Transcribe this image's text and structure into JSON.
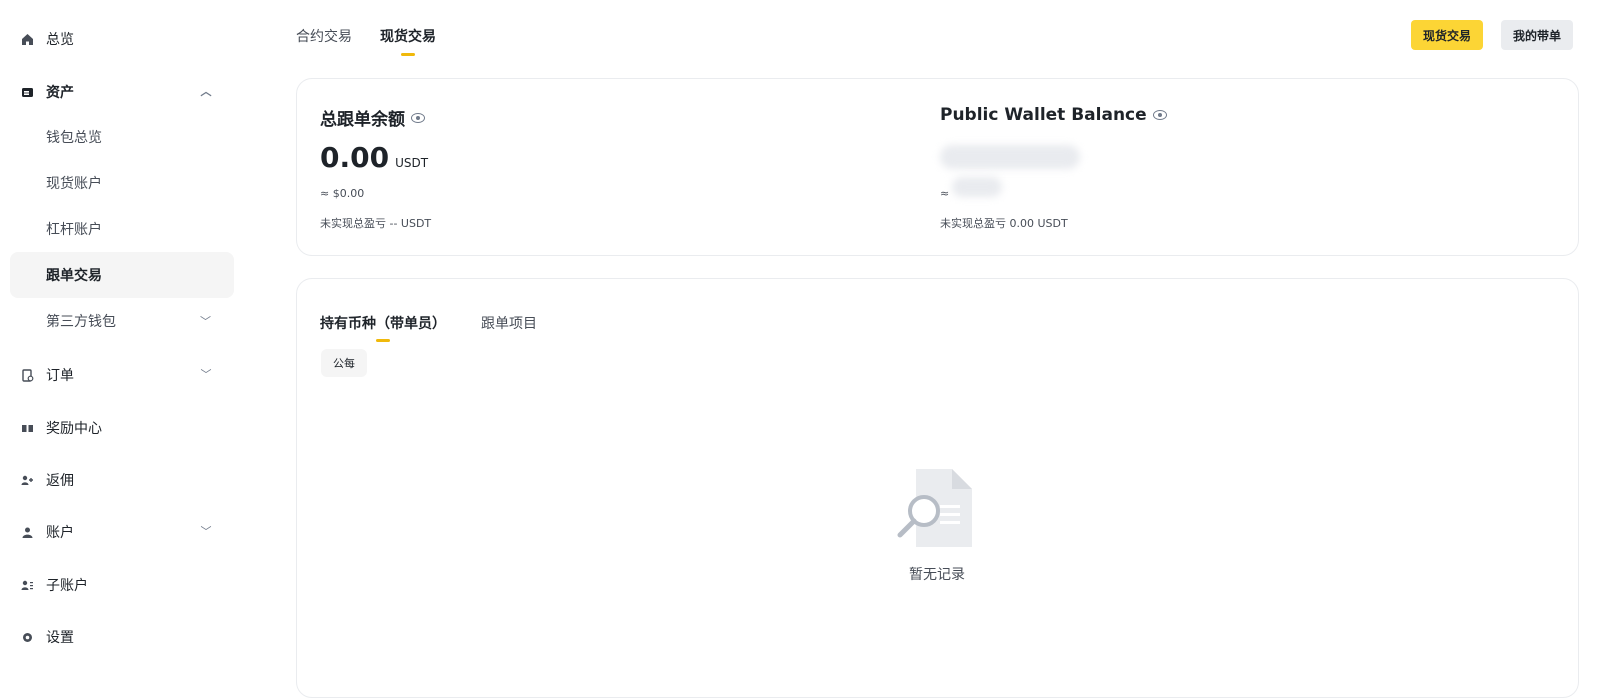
{
  "sidebar": {
    "overview": "总览",
    "assets": "资产",
    "assets_sub": [
      "钱包总览",
      "现货账户",
      "杠杆账户",
      "跟单交易",
      "第三方钱包"
    ],
    "orders": "订单",
    "rewards": "奖励中心",
    "rebate": "返佣",
    "account": "账户",
    "subaccount": "子账户",
    "settings": "设置"
  },
  "top_tabs": [
    "合约交易",
    "现货交易"
  ],
  "buttons": {
    "spot_trade": "现货交易",
    "my_lead": "我的带单"
  },
  "balance_left": {
    "title": "总跟单余额",
    "amount": "0.00",
    "unit": "USDT",
    "usd": "≈ $0.00",
    "pnl": "未实现总盈亏  -- USDT"
  },
  "balance_right": {
    "title": "Public Wallet Balance",
    "usd_prefix": "≈",
    "pnl": "未实现总盈亏  0.00 USDT"
  },
  "inner_tabs": [
    "持有币种（带单员）",
    "跟单项目"
  ],
  "chip": "公每",
  "empty_text": "暂无记录"
}
